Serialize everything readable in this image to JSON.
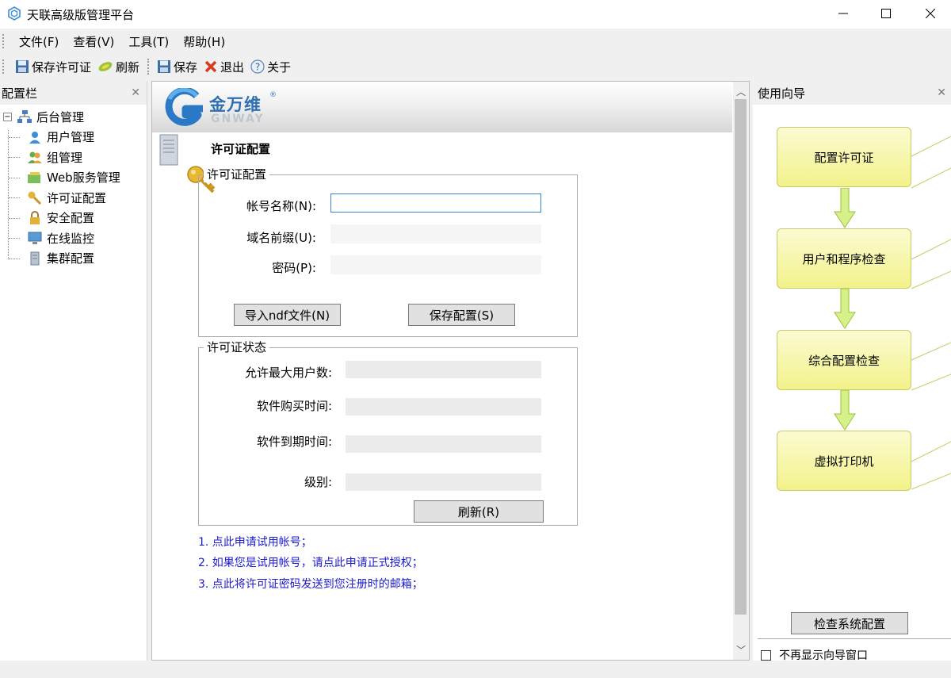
{
  "window": {
    "title": "天联高级版管理平台"
  },
  "menu": [
    {
      "label": "文件(F)"
    },
    {
      "label": "查看(V)"
    },
    {
      "label": "工具(T)"
    },
    {
      "label": "帮助(H)"
    }
  ],
  "toolbar": {
    "save_license": "保存许可证",
    "refresh": "刷新",
    "save": "保存",
    "exit": "退出",
    "about": "关于"
  },
  "left_panel": {
    "title": "配置栏",
    "root": "后台管理",
    "items": [
      {
        "label": "用户管理",
        "icon": "user-icon"
      },
      {
        "label": "组管理",
        "icon": "group-icon"
      },
      {
        "label": "Web服务管理",
        "icon": "web-service-icon"
      },
      {
        "label": "许可证配置",
        "icon": "key-icon"
      },
      {
        "label": "安全配置",
        "icon": "lock-icon"
      },
      {
        "label": "在线监控",
        "icon": "monitor-icon"
      },
      {
        "label": "集群配置",
        "icon": "cluster-icon"
      }
    ]
  },
  "logo": {
    "cn": "金万维",
    "en": "GNWAY",
    "reg": "®"
  },
  "main": {
    "section_title": "许可证配置",
    "license_config": {
      "legend": "许可证配置",
      "account_label": "帐号名称(N):",
      "account_value": "",
      "domain_label": "域名前缀(U):",
      "domain_value": "",
      "password_label": "密码(P):",
      "password_value": "",
      "import_button": "导入ndf文件(N)",
      "save_button": "保存配置(S)"
    },
    "license_status": {
      "legend": "许可证状态",
      "max_users_label": "允许最大用户数:",
      "purchase_label": "软件购买时间:",
      "expire_label": "软件到期时间:",
      "level_label": "级别:",
      "refresh_button": "刷新(R)"
    },
    "links": [
      "1.  点此申请试用帐号；",
      "2.  如果您是试用帐号，请点此申请正式授权；",
      "3.  点此将许可证密码发送到您注册时的邮箱；"
    ]
  },
  "right_panel": {
    "title": "使用向导",
    "steps": [
      "配置许可证",
      "用户和程序检查",
      "综合配置检查",
      "虚拟打印机"
    ],
    "check_button": "检查系统配置",
    "no_show_label": "不再显示向导窗口"
  },
  "colors": {
    "link": "#1b1bd0",
    "flow_fill": "#f2f28a",
    "logo_blue": "#2d6fb3"
  }
}
